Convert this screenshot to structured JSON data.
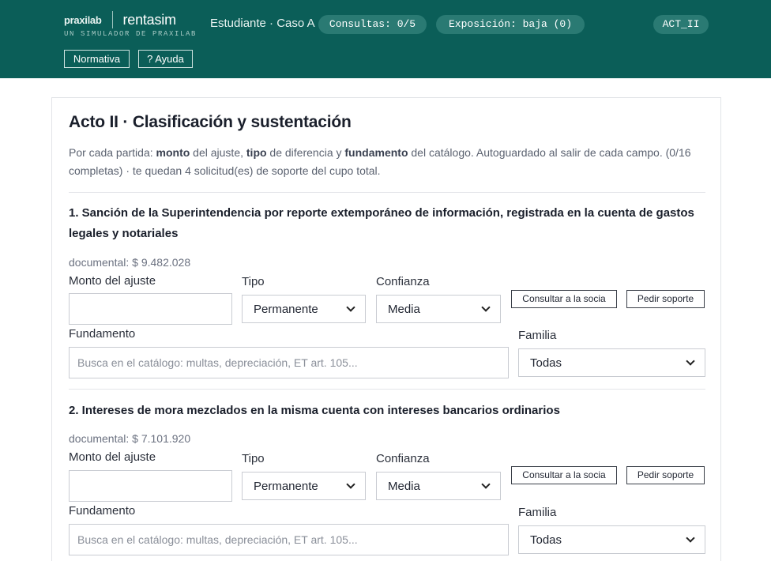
{
  "header": {
    "brand_left": "praxilab",
    "brand_right": "rentasim",
    "tagline": "UN SIMULADOR DE PRAXILAB",
    "role": "Estudiante · Caso A",
    "consultas": "Consultas: 0/5",
    "exposicion": "Exposición: baja (0)",
    "act": "ACT_II",
    "normativa_label": "Normativa",
    "ayuda_label": "? Ayuda"
  },
  "main": {
    "title": "Acto II · Clasificación y sustentación",
    "intro": {
      "p1": "Por cada partida: ",
      "b1": "monto",
      "p2": " del ajuste, ",
      "b2": "tipo",
      "p3": " de diferencia y ",
      "b3": "fundamento",
      "p4": " del catálogo. Autoguardado al salir de cada campo. (0/16 completas) · te quedan 4 solicitud(es) de soporte del cupo total."
    },
    "labels": {
      "monto": "Monto del ajuste",
      "tipo": "Tipo",
      "confianza": "Confianza",
      "fundamento": "Fundamento",
      "familia": "Familia",
      "consultar": "Consultar a la socia",
      "pedir": "Pedir soporte",
      "fundamento_placeholder": "Busca en el catálogo: multas, depreciación, ET art. 105..."
    },
    "items": [
      {
        "title": "1. Sanción de la Superintendencia por reporte extemporáneo de información, registrada en la cuenta de gastos legales y notariales",
        "documental": "documental: $ 9.482.028",
        "monto_value": "",
        "tipo": "Permanente",
        "confianza": "Media",
        "familia": "Todas"
      },
      {
        "title": "2. Intereses de mora mezclados en la misma cuenta con intereses bancarios ordinarios",
        "documental": "documental: $ 7.101.920",
        "monto_value": "",
        "tipo": "Permanente",
        "confianza": "Media",
        "familia": "Todas"
      }
    ]
  }
}
